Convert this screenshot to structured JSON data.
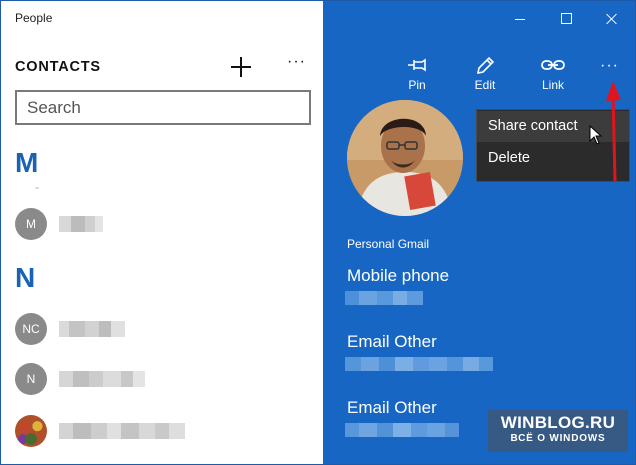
{
  "window": {
    "title": "People"
  },
  "left": {
    "heading": "CONTACTS",
    "add_icon": "plus-icon",
    "more_icon": "more-icon",
    "more_text": "···",
    "search": {
      "placeholder": "Search",
      "value": ""
    },
    "groups": [
      {
        "letter": "M",
        "contacts": [
          {
            "initials": "M",
            "avatar": "initials"
          }
        ]
      },
      {
        "letter": "N",
        "contacts": [
          {
            "initials": "NC",
            "avatar": "initials"
          },
          {
            "initials": "N",
            "avatar": "initials"
          },
          {
            "initials": "",
            "avatar": "photo"
          }
        ]
      }
    ]
  },
  "right": {
    "commands": [
      {
        "label": "Pin",
        "icon": "pin-icon"
      },
      {
        "label": "Edit",
        "icon": "pencil-icon"
      },
      {
        "label": "Link",
        "icon": "link-icon"
      }
    ],
    "more_text": "···",
    "account_label": "Personal Gmail",
    "fields": [
      {
        "label": "Mobile phone"
      },
      {
        "label": "Email Other"
      },
      {
        "label": "Email Other"
      }
    ]
  },
  "menu": {
    "items": [
      {
        "label": "Share contact",
        "state": "hover"
      },
      {
        "label": "Delete",
        "state": "normal"
      }
    ]
  },
  "watermark": {
    "title": "WINBLOG.RU",
    "subtitle": "ВСЁ О WINDOWS"
  },
  "colors": {
    "accent": "#1766c4",
    "group_letter": "#1a63b2",
    "menu_bg": "#2b2b2b",
    "arrow": "#e0141c"
  }
}
